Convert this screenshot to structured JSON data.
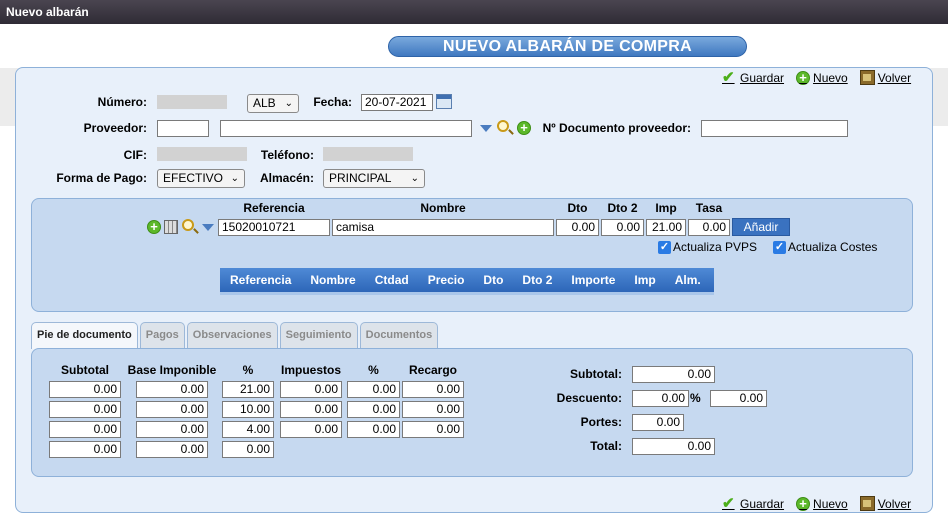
{
  "window": {
    "title": "Nuevo albarán"
  },
  "page": {
    "title": "NUEVO ALBARÁN DE COMPRA"
  },
  "actions": {
    "save": "Guardar",
    "new": "Nuevo",
    "back": "Volver"
  },
  "header": {
    "numero_label": "Número:",
    "serie": "ALB",
    "fecha_label": "Fecha:",
    "fecha": "20-07-2021",
    "proveedor_label": "Proveedor:",
    "proveedor_code": "",
    "proveedor_name": "",
    "doc_prov_label": "Nº Documento proveedor:",
    "doc_prov": "",
    "cif_label": "CIF:",
    "telefono_label": "Teléfono:",
    "forma_pago_label": "Forma de Pago:",
    "forma_pago": "EFECTIVO",
    "almacen_label": "Almacén:",
    "almacen": "PRINCIPAL"
  },
  "line_entry": {
    "headers": {
      "referencia": "Referencia",
      "nombre": "Nombre",
      "dto": "Dto",
      "dto2": "Dto 2",
      "imp": "Imp",
      "tasa": "Tasa"
    },
    "referencia": "15020010721",
    "nombre": "camisa",
    "dto": "0.00",
    "dto2": "0.00",
    "imp": "21.00",
    "tasa": "0.00",
    "add_button": "Añadir",
    "actualiza_pvps": "Actualiza PVPS",
    "actualiza_costes": "Actualiza Costes"
  },
  "lines_table": {
    "columns": [
      "Referencia",
      "Nombre",
      "Ctdad",
      "Precio",
      "Dto",
      "Dto 2",
      "Importe",
      "Imp",
      "Alm."
    ]
  },
  "tabs": [
    "Pie de documento",
    "Pagos",
    "Observaciones",
    "Seguimiento",
    "Documentos"
  ],
  "footer": {
    "headers": {
      "subtotal": "Subtotal",
      "base": "Base Imponible",
      "pct": "%",
      "impuestos": "Impuestos",
      "pct2": "%",
      "recargo": "Recargo"
    },
    "rows": [
      {
        "subtotal": "0.00",
        "base": "0.00",
        "pct": "21.00",
        "impuestos": "0.00",
        "pct2": "0.00",
        "recargo": "0.00"
      },
      {
        "subtotal": "0.00",
        "base": "0.00",
        "pct": "10.00",
        "impuestos": "0.00",
        "pct2": "0.00",
        "recargo": "0.00"
      },
      {
        "subtotal": "0.00",
        "base": "0.00",
        "pct": "4.00",
        "impuestos": "0.00",
        "pct2": "0.00",
        "recargo": "0.00"
      },
      {
        "subtotal": "0.00",
        "base": "0.00",
        "pct": "0.00"
      }
    ],
    "totals": {
      "subtotal_label": "Subtotal:",
      "subtotal": "0.00",
      "descuento_label": "Descuento:",
      "descuento_pct": "0.00",
      "pct_sign": "%",
      "descuento": "0.00",
      "portes_label": "Portes:",
      "portes": "0.00",
      "total_label": "Total:",
      "total": "0.00"
    }
  }
}
